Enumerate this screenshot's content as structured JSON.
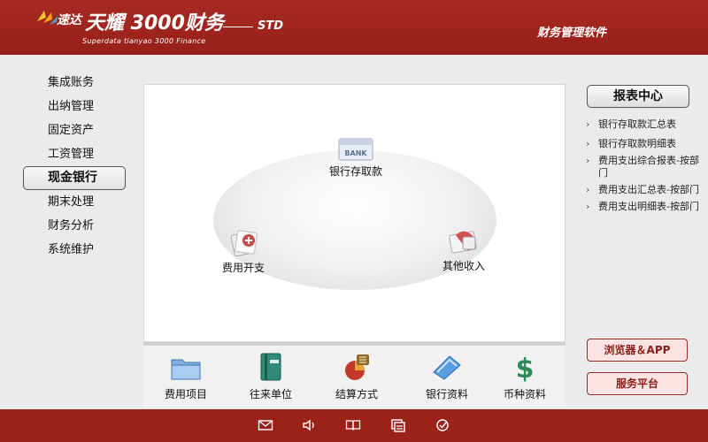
{
  "header": {
    "brand": "速达",
    "title": "天耀 3000财务",
    "subtitle": "Superdata tianyao 3000 Finance",
    "edition": "STD",
    "right_title": "财务管理软件"
  },
  "left_nav": {
    "items": [
      {
        "label": "集成账务"
      },
      {
        "label": "出纳管理"
      },
      {
        "label": "固定资产"
      },
      {
        "label": "工资管理"
      },
      {
        "label": "现金银行",
        "active": true
      },
      {
        "label": "期末处理"
      },
      {
        "label": "财务分析"
      },
      {
        "label": "系统维护"
      }
    ]
  },
  "flow": {
    "bank": {
      "label": "银行存取款",
      "icon": "bank-icon",
      "icon_text": "BANK"
    },
    "expense": {
      "label": "费用开支",
      "icon": "expense-icon"
    },
    "income": {
      "label": "其他收入",
      "icon": "income-icon"
    }
  },
  "toolbar": {
    "items": [
      {
        "label": "费用项目",
        "icon": "folder-icon"
      },
      {
        "label": "往来单位",
        "icon": "book-icon"
      },
      {
        "label": "结算方式",
        "icon": "settlement-icon"
      },
      {
        "label": "银行资料",
        "icon": "bank-data-icon"
      },
      {
        "label": "币种资料",
        "icon": "currency-icon"
      }
    ]
  },
  "report_center": {
    "title": "报表中心",
    "items": [
      {
        "label": "银行存取款汇总表"
      },
      {
        "label": "银行存取款明细表"
      },
      {
        "label": "费用支出综合报表-按部门"
      },
      {
        "label": "费用支出汇总表-按部门"
      },
      {
        "label": "费用支出明细表-按部门"
      }
    ]
  },
  "side_buttons": {
    "browser": "浏览器＆APP",
    "service": "服务平台"
  },
  "footer_icons": [
    "mail-icon",
    "speaker-icon",
    "help-book-icon",
    "window-icon",
    "check-icon"
  ],
  "colors": {
    "header_red": "#a82a23",
    "footer_red": "#9b2219",
    "background": "#ebebeb"
  }
}
